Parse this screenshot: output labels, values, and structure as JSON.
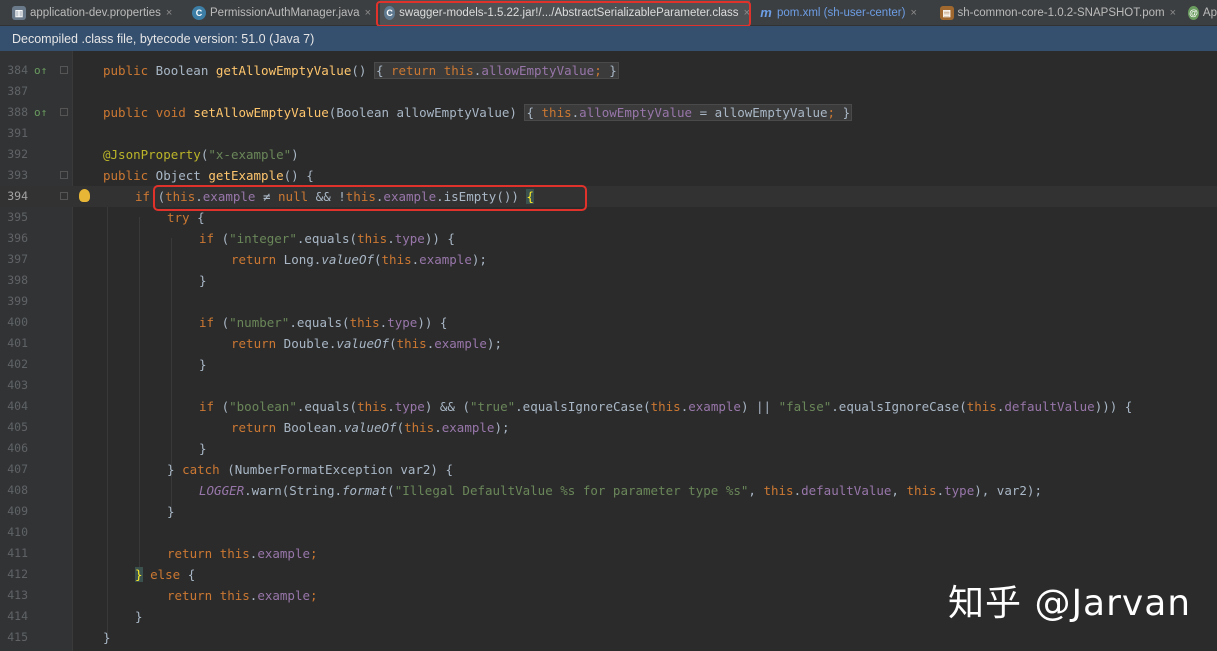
{
  "tabs": [
    {
      "label": "application-dev.properties",
      "icon": "properties-file-icon"
    },
    {
      "label": "PermissionAuthManager.java",
      "icon": "java-class-icon"
    },
    {
      "label": "swagger-models-1.5.22.jar!/.../AbstractSerializableParameter.class",
      "icon": "class-file-icon",
      "active": true
    },
    {
      "label": "pom.xml (sh-user-center)",
      "icon": "maven-icon"
    },
    {
      "label": "sh-common-core-1.0.2-SNAPSHOT.pom",
      "icon": "pom-file-icon"
    },
    {
      "label": "Ap",
      "icon": "spring-app-icon"
    }
  ],
  "banner": {
    "text": "Decompiled .class file, bytecode version: 51.0 (Java 7)"
  },
  "line_numbers": [
    "384",
    "387",
    "388",
    "391",
    "392",
    "393",
    "394",
    "395",
    "396",
    "397",
    "398",
    "399",
    "400",
    "401",
    "402",
    "403",
    "404",
    "405",
    "406",
    "407",
    "408",
    "409",
    "410",
    "411",
    "412",
    "413",
    "414",
    "415"
  ],
  "code": {
    "l384": {
      "kw": "public",
      "type": " Boolean ",
      "fn": "getAllowEmptyValue",
      "tail": "() ",
      "body_open": "{ ",
      "ret": "return ",
      "this": "this",
      "dot": ".",
      "field": "allowEmptyValue",
      "semi": "; ",
      "body_close": "}"
    },
    "l388": {
      "kw1": "public ",
      "kw2": "void ",
      "fn": "setAllowEmptyValue",
      "params": "(Boolean allowEmptyValue) ",
      "body_open": "{ ",
      "this": "this",
      "dot": ".",
      "field": "allowEmptyValue",
      "assign": " = allowEmptyValue",
      "semi": "; ",
      "body_close": "}"
    },
    "l392": {
      "ann": "@JsonProperty",
      "open": "(",
      "str": "\"x-example\"",
      "close": ")"
    },
    "l393": {
      "kw": "public",
      "type": " Object ",
      "fn": "getExample",
      "tail": "() {"
    },
    "l394": {
      "kw": "if",
      "sp": " (",
      "this1": "this",
      "dot1": ".",
      "field1": "example",
      "op": " ≠ ",
      "null": "null",
      "and": " && !",
      "this2": "this",
      "dot2": ".",
      "field2": "example",
      "call": ".isEmpty()) ",
      "brace": "{"
    },
    "l395": {
      "kw": "try",
      "tail": " {"
    },
    "l396": {
      "kw": "if",
      "open": " (",
      "str": "\"integer\"",
      "call": ".equals(",
      "this": "this",
      "dot": ".",
      "field": "type",
      "close": ")) {"
    },
    "l397": {
      "kw": "return",
      "pre": " Long.",
      "method": "valueOf",
      "open": "(",
      "this": "this",
      "dot": ".",
      "field": "example",
      "close": ");"
    },
    "l398": {
      "text": "}"
    },
    "l400": {
      "kw": "if",
      "open": " (",
      "str": "\"number\"",
      "call": ".equals(",
      "this": "this",
      "dot": ".",
      "field": "type",
      "close": ")) {"
    },
    "l401": {
      "kw": "return",
      "pre": " Double.",
      "method": "valueOf",
      "open": "(",
      "this": "this",
      "dot": ".",
      "field": "example",
      "close": ");"
    },
    "l402": {
      "text": "}"
    },
    "l404": {
      "kw": "if",
      "open": " (",
      "str1": "\"boolean\"",
      "call1": ".equals(",
      "this1": "this",
      "dot1": ".",
      "field1": "type",
      "mid1": ") && (",
      "str2": "\"true\"",
      "call2": ".equalsIgnoreCase(",
      "this2": "this",
      "dot2": ".",
      "field2": "example",
      "mid2": ") || ",
      "str3": "\"false\"",
      "call3": ".equalsIgnoreCase(",
      "this3": "this",
      "dot3": ".",
      "field3": "defaultValue",
      "close": "))) {"
    },
    "l405": {
      "kw": "return",
      "pre": " Boolean.",
      "method": "valueOf",
      "open": "(",
      "this": "this",
      "dot": ".",
      "field": "example",
      "close": ");"
    },
    "l406": {
      "text": "}"
    },
    "l407": {
      "close": "} ",
      "kw": "catch",
      "tail": " (NumberFormatException var2) {"
    },
    "l408": {
      "logger": "LOGGER",
      "warn": ".warn(String.",
      "method": "format",
      "open": "(",
      "str": "\"Illegal DefaultValue %s for parameter type %s\"",
      "comma1": ", ",
      "this1": "this",
      "dot1": ".",
      "field1": "defaultValue",
      "comma2": ", ",
      "this2": "this",
      "dot2": ".",
      "field2": "type",
      "close": "), var2);"
    },
    "l409": {
      "text": "}"
    },
    "l411": {
      "kw": "return",
      "sp": " ",
      "this": "this",
      "dot": ".",
      "field": "example",
      "semi": ";"
    },
    "l412": {
      "brace": "}",
      "sp": " ",
      "kw": "else",
      "tail": " {"
    },
    "l413": {
      "kw": "return",
      "sp": " ",
      "this": "this",
      "dot": ".",
      "field": "example",
      "semi": ";"
    },
    "l414": {
      "text": "}"
    },
    "l415": {
      "text": "}"
    }
  },
  "watermark": {
    "text": "知乎 @Jarvan"
  },
  "colors": {
    "keyword": "#cc7832",
    "function": "#ffc66d",
    "field": "#9876aa",
    "string": "#6a8759",
    "annotation": "#bbb529",
    "highlight_outline": "#e0322b",
    "banner": "#354f6e"
  }
}
